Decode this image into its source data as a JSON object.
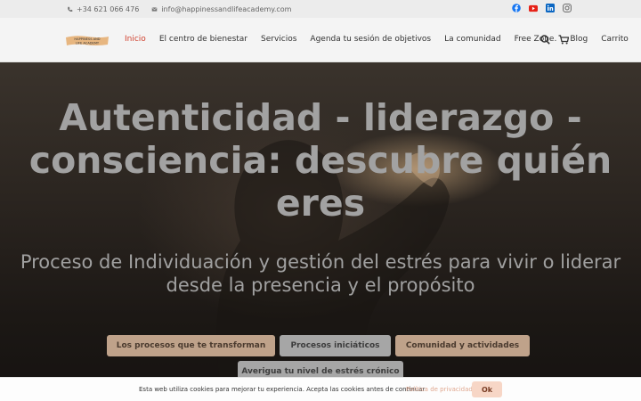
{
  "topbar": {
    "phone": "+34 621 066 476",
    "email": "info@happinessandlifeacademy.com",
    "social": [
      "facebook-icon",
      "youtube-icon",
      "linkedin-icon",
      "instagram-icon"
    ]
  },
  "header": {
    "logo_text_line1": "HAPPINESS AND",
    "logo_text_line2": "LIFE ACADEMY",
    "nav": [
      {
        "label": "Inicio",
        "active": true
      },
      {
        "label": "El centro de bienestar"
      },
      {
        "label": "Servicios"
      },
      {
        "label": "Agenda tu sesión de objetivos"
      },
      {
        "label": "La comunidad"
      },
      {
        "label": "Free Zone."
      },
      {
        "label": "Blog"
      },
      {
        "label": "Carrito"
      }
    ]
  },
  "hero": {
    "title": "Autenticidad - liderazgo - consciencia: descubre quién eres",
    "subtitle": "Proceso de Individuación y gestión del estrés para vivir o liderar desde la presencia y el propósito",
    "buttons": [
      "Los procesos que te transforman",
      "Procesos iniciáticos",
      "Comunidad y actividades",
      "Averigua tu nivel de estrés crónico"
    ]
  },
  "cookie": {
    "message": "Esta web utiliza cookies para mejorar tu experiencia. Acepta las cookies antes de continuar",
    "link": "Política de privacidad",
    "ok": "Ok"
  },
  "colors": {
    "accent": "#d0412f",
    "button_warm": "#bfa28a",
    "button_grey": "#a6a6a6",
    "cookie_ok": "#f7d6c6"
  }
}
